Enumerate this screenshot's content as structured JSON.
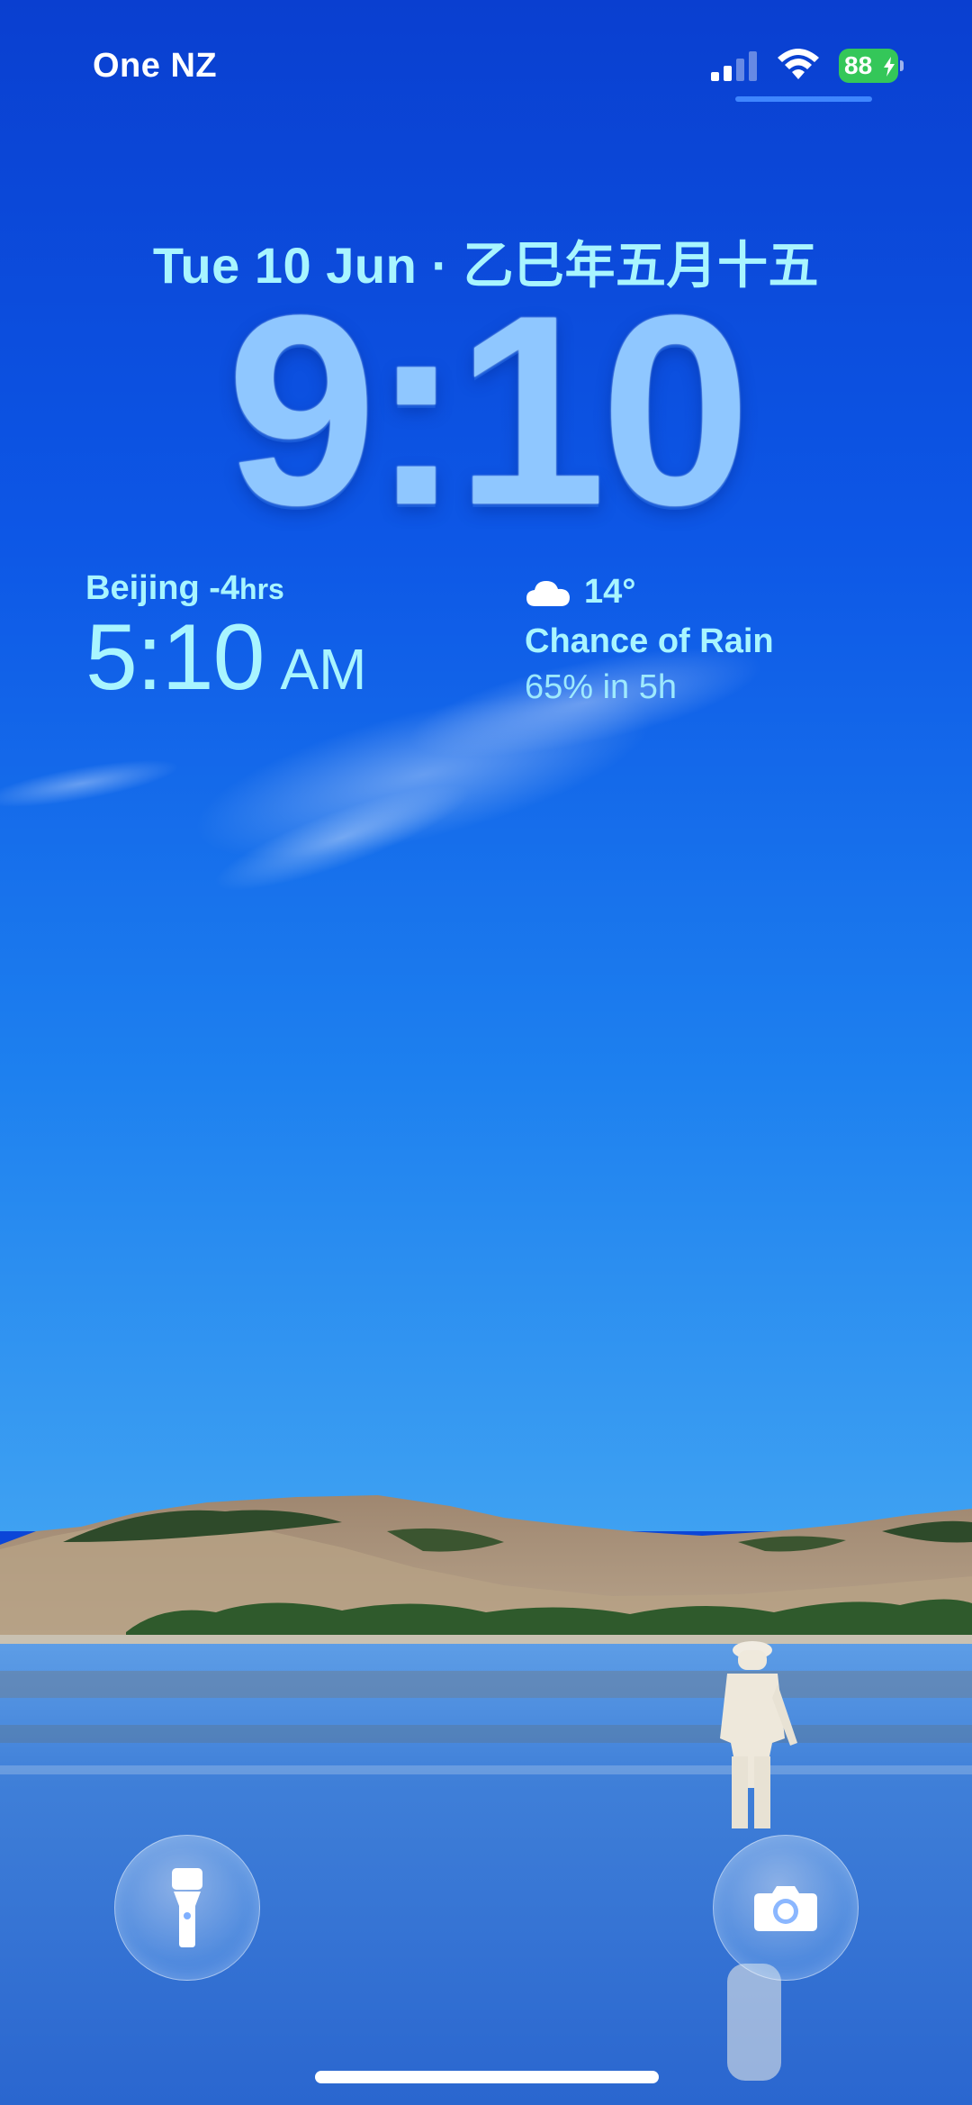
{
  "status_bar": {
    "carrier": "One NZ",
    "battery_percent": "88",
    "battery_charging": true,
    "signal_bars_active": 2,
    "signal_bars_total": 4,
    "wifi_icon": "wifi-icon",
    "battery_color": "#34c759"
  },
  "lock_screen": {
    "date": "Tue 10 Jun · 乙巳年五月十五",
    "time": "9:10",
    "text_color": "#a8f5ff",
    "clock_color": "#8fc7ff"
  },
  "widgets": {
    "world_clock": {
      "city": "Beijing",
      "offset": " -4",
      "offset_unit": "hrs",
      "time": "5:10",
      "ampm": "AM"
    },
    "weather": {
      "icon": "cloud-icon",
      "temperature": "14°",
      "condition": "Chance of Rain",
      "detail": "65% in 5h"
    }
  },
  "quick_actions": {
    "left": "flashlight-icon",
    "right": "camera-icon"
  }
}
